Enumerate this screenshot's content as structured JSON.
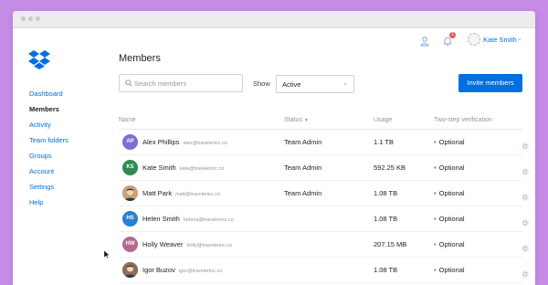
{
  "colors": {
    "background": "#c78de6",
    "accent": "#0070e0",
    "text": "#1e1e1e",
    "muted": "#8e96a0"
  },
  "header": {
    "user_name": "Kate Smith",
    "notification_count": "1"
  },
  "sidebar": {
    "items": [
      {
        "label": "Dashboard",
        "active": false
      },
      {
        "label": "Members",
        "active": true
      },
      {
        "label": "Activity",
        "active": false
      },
      {
        "label": "Team folders",
        "active": false
      },
      {
        "label": "Groups",
        "active": false
      },
      {
        "label": "Account",
        "active": false
      },
      {
        "label": "Settings",
        "active": false
      },
      {
        "label": "Help",
        "active": false
      }
    ]
  },
  "main": {
    "title": "Members",
    "search_placeholder": "Search members",
    "show_label": "Show",
    "filter_value": "Active",
    "invite_label": "Invite members",
    "columns": {
      "name": "Name",
      "status": "Status",
      "usage": "Usage",
      "two_step": "Two-step verification"
    },
    "members": [
      {
        "initials": "AP",
        "color": "#7b6fd6",
        "photo": false,
        "name": "Alex Phillips",
        "email": "alex@travelerinc.co",
        "status": "Team Admin",
        "usage": "1.1 TB",
        "two_step": "Optional"
      },
      {
        "initials": "KS",
        "color": "#2f8a52",
        "photo": false,
        "name": "Kate Smith",
        "email": "kate@travelerinc.co",
        "status": "Team Admin",
        "usage": "592.25 KB",
        "two_step": "Optional"
      },
      {
        "initials": "",
        "color": "#c7a27a",
        "photo": true,
        "name": "Matt Park",
        "email": "matt@travelerinc.co",
        "status": "Team Admin",
        "usage": "1.08 TB",
        "two_step": "Optional"
      },
      {
        "initials": "HS",
        "color": "#2a7fd4",
        "photo": false,
        "name": "Helen Smith",
        "email": "helena@travelerinc.co",
        "status": "",
        "usage": "1.08 TB",
        "two_step": "Optional"
      },
      {
        "initials": "HW",
        "color": "#b2698f",
        "photo": false,
        "name": "Holly Weaver",
        "email": "holly@travelerinc.co",
        "status": "",
        "usage": "207.15 MB",
        "two_step": "Optional"
      },
      {
        "initials": "",
        "color": "#8a6e5a",
        "photo": true,
        "name": "Igor Buzov",
        "email": "igor@travelerinc.co",
        "status": "",
        "usage": "1.08 TB",
        "two_step": "Optional"
      }
    ]
  }
}
